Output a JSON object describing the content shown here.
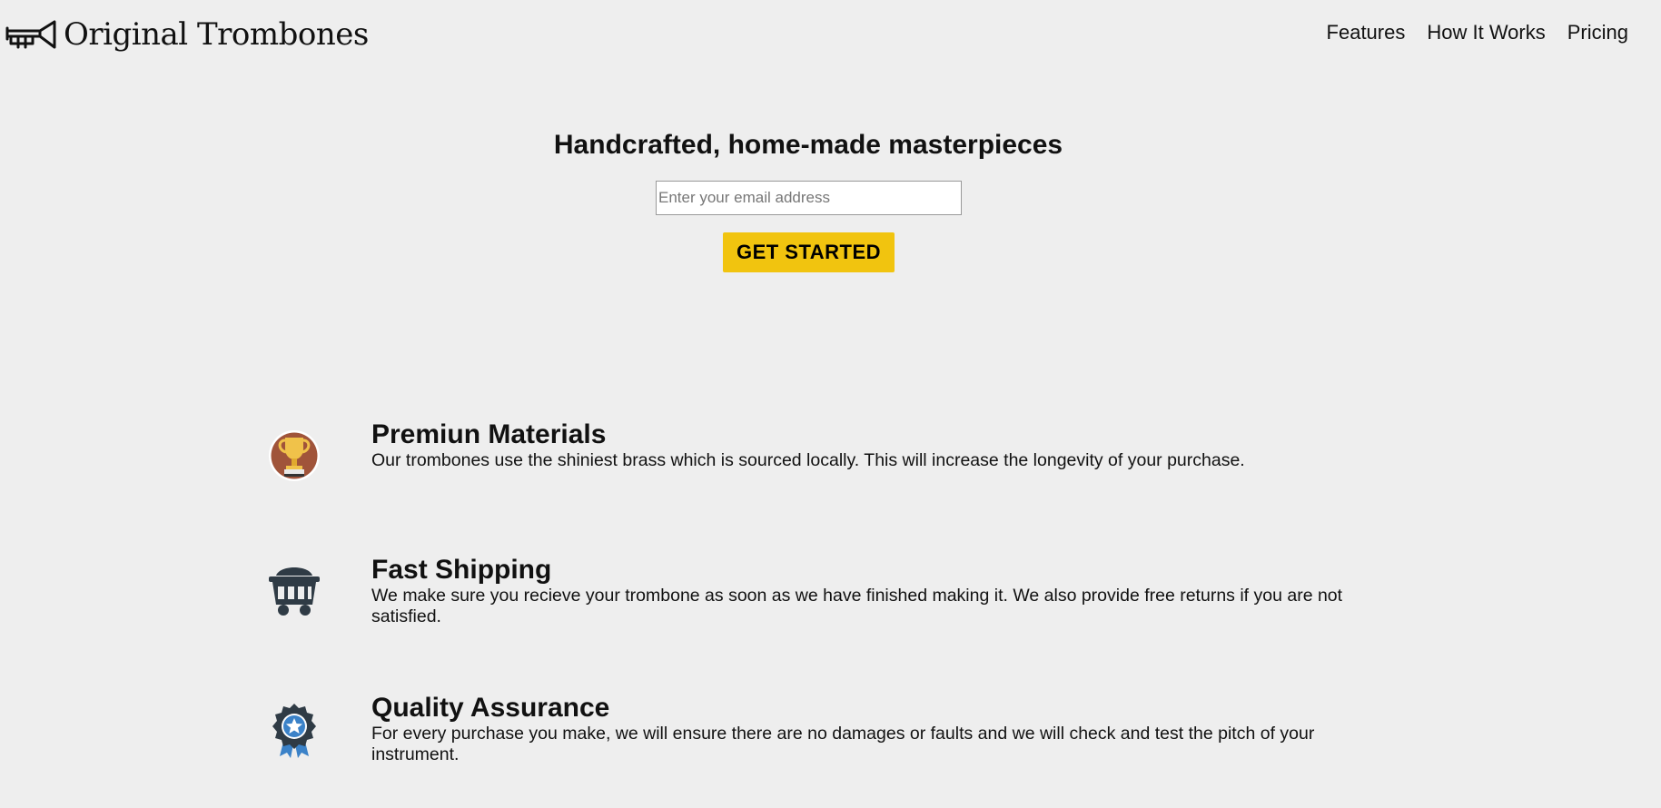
{
  "header": {
    "logo_text": "Original Trombones",
    "logo_icon": "trombone-icon",
    "nav": [
      {
        "label": "Features"
      },
      {
        "label": "How It Works"
      },
      {
        "label": "Pricing"
      }
    ]
  },
  "hero": {
    "title": "Handcrafted, home-made masterpieces",
    "email_placeholder": "Enter your email address",
    "email_value": "",
    "cta_label": "GET STARTED"
  },
  "features": [
    {
      "icon": "trophy-icon",
      "title": "Premiun Materials",
      "description": "Our trombones use the shiniest brass which is sourced locally. This will increase the longevity of your purchase."
    },
    {
      "icon": "mine-cart-icon",
      "title": "Fast Shipping",
      "description": "We make sure you recieve your trombone as soon as we have finished making it. We also provide free returns if you are not satisfied."
    },
    {
      "icon": "award-ribbon-icon",
      "title": "Quality Assurance",
      "description": "For every purchase you make, we will ensure there are no damages or faults and we will check and test the pitch of your instrument."
    }
  ],
  "colors": {
    "background": "#eeeeee",
    "cta": "#f1c40f",
    "text": "#111111"
  }
}
